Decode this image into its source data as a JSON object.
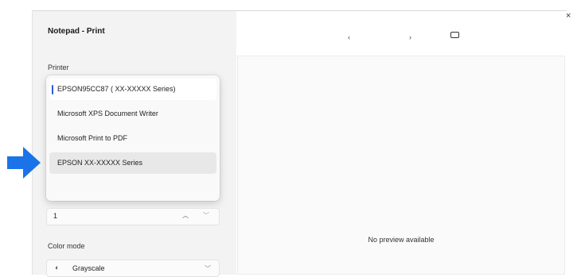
{
  "window": {
    "title": "Notepad - Print"
  },
  "preview_nav": {
    "prev_icon": "chevron-left-icon",
    "next_icon": "chevron-right-icon",
    "fit_icon": "fit-page-icon"
  },
  "printer": {
    "label": "Printer",
    "options": [
      "EPSON95CC87 ( XX-XXXXX Series)",
      "Microsoft XPS Document Writer",
      "Microsoft Print to PDF",
      "EPSON  XX-XXXXX Series"
    ],
    "selected_index": 0,
    "highlighted_index": 3
  },
  "copies": {
    "value": "1"
  },
  "color_mode": {
    "label": "Color mode",
    "value": "Grayscale",
    "icon": "grayscale-icon"
  },
  "preview": {
    "text": "No preview available"
  },
  "colors": {
    "accent": "#2a5bd7",
    "arrow": "#1a73e8"
  }
}
